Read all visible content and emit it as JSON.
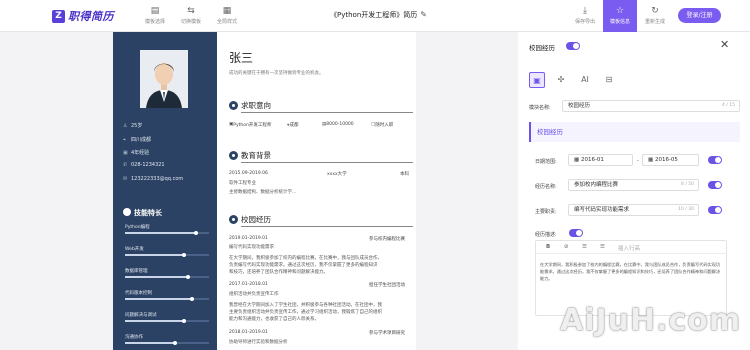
{
  "app": {
    "logo_text": "职得简历",
    "logo_mark": "Z"
  },
  "toolbar": {
    "items": [
      {
        "label": "模板选择",
        "icon": "template-icon",
        "glyph": "▤"
      },
      {
        "label": "切换模板",
        "icon": "switch-icon",
        "glyph": "⇆"
      },
      {
        "label": "全局样式",
        "icon": "style-icon",
        "glyph": "▦"
      }
    ]
  },
  "doc_title": "《Python开发工程师》简历",
  "right_tools": [
    {
      "label": "保存导出",
      "icon": "download-icon",
      "glyph": "⤓",
      "active": false
    },
    {
      "label": "模板信息",
      "icon": "info-icon",
      "glyph": "☆",
      "active": true
    },
    {
      "label": "重新生成",
      "icon": "refresh-icon",
      "glyph": "↻",
      "active": false
    }
  ],
  "login_label": "登录/注册",
  "resume": {
    "name": "张三",
    "motto": "成功的关键在于拥有一次坚持做到专业的机会。",
    "info": [
      {
        "icon": "age-icon",
        "glyph": "♙",
        "text": "25岁"
      },
      {
        "icon": "location-icon",
        "glyph": "⌖",
        "text": "四川成都"
      },
      {
        "icon": "experience-icon",
        "glyph": "▣",
        "text": "4年经验"
      },
      {
        "icon": "phone-icon",
        "glyph": "✆",
        "text": "028-1234321"
      },
      {
        "icon": "email-icon",
        "glyph": "✉",
        "text": "123222333@qq.com"
      }
    ],
    "skills_title": "技能特长",
    "skills": [
      {
        "name": "Python编程",
        "level": 0.85
      },
      {
        "name": "Web开发",
        "level": 0.7
      },
      {
        "name": "数据库管理",
        "level": 0.75
      },
      {
        "name": "代码版本控制",
        "level": 0.8
      },
      {
        "name": "问题解决与调试",
        "level": 0.7
      },
      {
        "name": "沟通协作",
        "level": 0.6
      }
    ],
    "intent": {
      "title": "求职意向",
      "items": [
        "Python开发工程师",
        "成都",
        "8000-10000",
        "随时入职"
      ]
    },
    "education": {
      "title": "教育背景",
      "date": "2015.09-2019.06",
      "school": "xxxx大学",
      "degree": "本科",
      "major": "软件工程专业",
      "desc": "主修数据结构、数据分析统计学..."
    },
    "campus": {
      "title": "校园经历",
      "entries": [
        {
          "date": "2019.01-2019.01",
          "role": "参与校内编程比赛",
          "subtitle": "编写代码实现功能需求",
          "lines": [
            "在大学期间，我积极参加了校内的编程比赛，在比赛中，我与团队成员合作，",
            "负责编写代码实现功能需求。通过这次经历，我不仅掌握了更多的编程知识",
            "和技巧，还培养了团队合作精神和问题解决能力。"
          ]
        },
        {
          "date": "2017.01-2018.01",
          "role": "担任学生社团活动",
          "subtitle": "组织活动并负责宣传工作",
          "lines": [
            "我曾经在大学期间加入了学生社团，并积极参与各种社团活动。在社团中，我",
            "主要负责组织活动并负责宣传工作，通过学习组织活动，我锻炼了自己的组织",
            "能力和沟通能力，也收获了自己的人际关系。"
          ]
        },
        {
          "date": "2018.01-2019.01",
          "role": "参与学术项目研究",
          "subtitle": "协助导师进行实验和数据分析",
          "lines": []
        }
      ]
    }
  },
  "panel": {
    "title": "校园经历",
    "module_name_label": "模块名称:",
    "module_name_value": "校园经历",
    "module_name_count": "4 / 15",
    "section_label": "校园经历",
    "tabs": [
      {
        "icon": "layout-icon",
        "glyph": "▣"
      },
      {
        "icon": "puzzle-icon",
        "glyph": "✣"
      },
      {
        "icon": "ai-icon",
        "glyph": "AI"
      },
      {
        "icon": "document-icon",
        "glyph": "⊟"
      }
    ],
    "date_label": "日期范围:",
    "date_start": "2016-01",
    "date_sep": "-",
    "date_end": "2016-05",
    "event_label": "经历名称:",
    "event_value": "参加校内编程比赛",
    "event_count": "8 / 50",
    "main_label": "主要职责:",
    "main_value": "编写代码实现功能需求",
    "main_count": "10 / 30",
    "desc_label": "经历描述:",
    "editor_tools": [
      "B",
      "⊘",
      "☰",
      "☰",
      "插入行高"
    ],
    "editor_text": "在大学期间，我积极参加了校内的编程比赛。在比赛中，我与团队成员合作，负责编写代码实现功能需求。通过这次经历，我不仅掌握了更多的编程知识和技巧，还培养了团队合作精神和问题解决能力。"
  },
  "watermark": "AiJuH.com",
  "colors": {
    "accent": "#7b5cf0",
    "sidebar": "#2c4264"
  }
}
